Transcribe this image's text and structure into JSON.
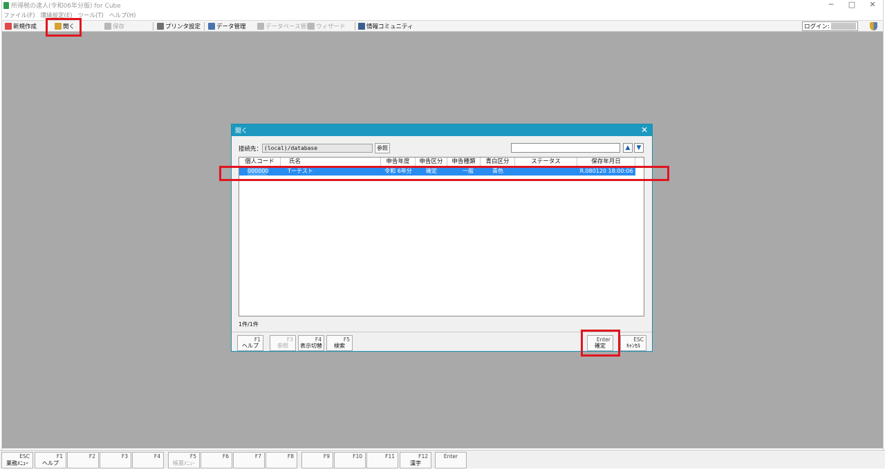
{
  "window": {
    "title": "所得税の達人(令和06年分版) for Cube",
    "controls": [
      "─",
      "□",
      "✕"
    ]
  },
  "menu": [
    "ファイル(F)",
    "環境設定(E)",
    "ツール(T)",
    "ヘルプ(H)"
  ],
  "toolbar": {
    "new_label": "新規作成",
    "open_label": "開く",
    "save_label": "保存",
    "printer_label": "プリンタ設定",
    "data_label": "データ管理",
    "db_label": "データベース管理",
    "wizard_label": "ウィザード",
    "community_label": "情報コミュニティ",
    "login_label": "ログイン:"
  },
  "dialog": {
    "title": "開く",
    "connection_label": "接続先：",
    "connection_value": "(local)/database",
    "ref_button": "参照",
    "up_arrow": "▲",
    "down_arrow": "▼",
    "columns": [
      "個人コード",
      "氏名",
      "申告年度",
      "申告区分",
      "申告種類",
      "青白区分",
      "ステータス",
      "保存年月日"
    ],
    "rows": [
      {
        "code": "000000",
        "name": "Tーテスト",
        "year": "令和 6年分",
        "category": "確定",
        "type": "一般",
        "blue_white": "青色",
        "status": "",
        "saved": "R.080120 18:00:06"
      }
    ],
    "count": "1件/1件",
    "fkeys": {
      "f1": {
        "key": "F1",
        "label": "ヘルプ"
      },
      "f3": {
        "key": "F3",
        "label": "参照"
      },
      "f4": {
        "key": "F4",
        "label": "表示切替"
      },
      "f5": {
        "key": "F5",
        "label": "検索"
      },
      "enter": {
        "key": "Enter",
        "label": "確定"
      },
      "esc": {
        "key": "ESC",
        "label": "ｷｬﾝｾﾙ"
      }
    }
  },
  "function_bar": {
    "esc": {
      "key": "ESC",
      "label": "業務ﾒﾆｭｰ"
    },
    "f1": {
      "key": "F1",
      "label": "ヘルプ"
    },
    "f2": {
      "key": "F2",
      "label": ""
    },
    "f3": {
      "key": "F3",
      "label": ""
    },
    "f4": {
      "key": "F4",
      "label": ""
    },
    "f5": {
      "key": "F5",
      "label": "帳票ﾒﾆｭｰ"
    },
    "f6": {
      "key": "F6",
      "label": ""
    },
    "f7": {
      "key": "F7",
      "label": ""
    },
    "f8": {
      "key": "F8",
      "label": ""
    },
    "f9": {
      "key": "F9",
      "label": ""
    },
    "f10": {
      "key": "F10",
      "label": ""
    },
    "f11": {
      "key": "F11",
      "label": ""
    },
    "f12": {
      "key": "F12",
      "label": "漢字"
    },
    "enter": {
      "key": "Enter",
      "label": ""
    }
  },
  "colors": {
    "dialog_titlebar": "#1d98bf",
    "selected_row": "#2b8cf0",
    "highlight": "#e0141e",
    "workspace": "#a9a9a9"
  }
}
